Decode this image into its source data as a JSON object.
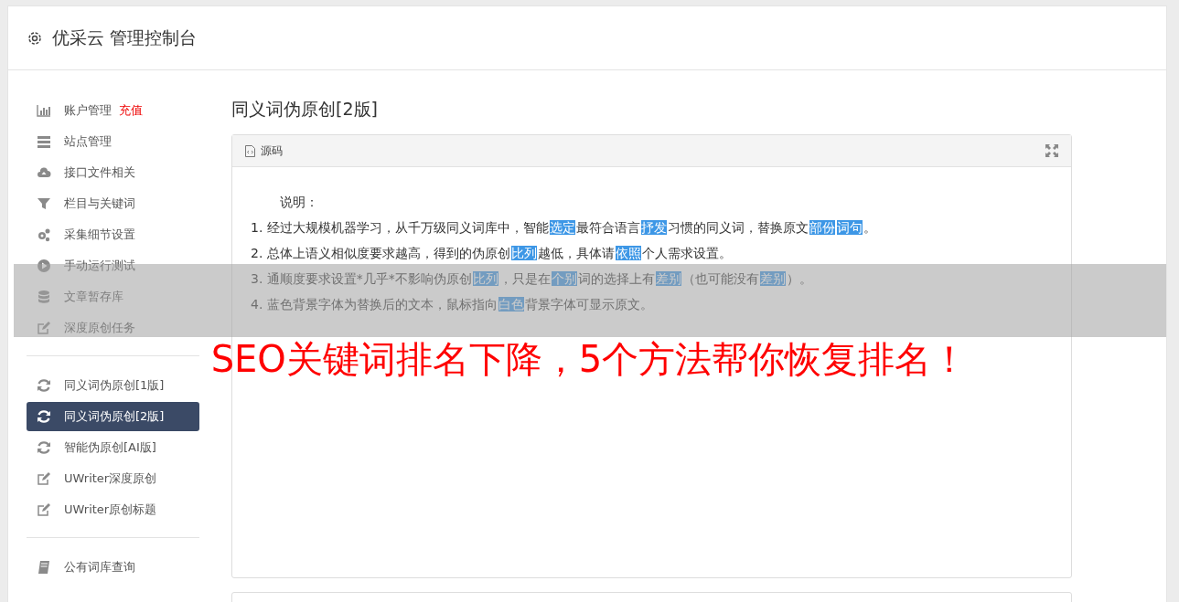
{
  "header": {
    "title": "优采云 管理控制台"
  },
  "sidebar": {
    "groups": [
      {
        "items": [
          {
            "label": "账户管理",
            "badge": "充值",
            "selected": false
          },
          {
            "label": "站点管理",
            "selected": false
          },
          {
            "label": "接口文件相关",
            "selected": false
          },
          {
            "label": "栏目与关键词",
            "selected": false
          },
          {
            "label": "采集细节设置",
            "selected": false
          },
          {
            "label": "手动运行测试",
            "selected": false
          },
          {
            "label": "文章暂存库",
            "selected": false
          },
          {
            "label": "深度原创任务",
            "selected": false
          }
        ]
      },
      {
        "items": [
          {
            "label": "同义词伪原创[1版]",
            "selected": false
          },
          {
            "label": "同义词伪原创[2版]",
            "selected": true
          },
          {
            "label": "智能伪原创[AI版]",
            "selected": false
          },
          {
            "label": "UWriter深度原创",
            "selected": false
          },
          {
            "label": "UWriter原创标题",
            "selected": false
          }
        ]
      },
      {
        "items": [
          {
            "label": "公有词库查询",
            "selected": false
          }
        ]
      }
    ]
  },
  "main": {
    "title": "同义词伪原创[2版]",
    "panel": {
      "tab": "源码",
      "intro": "说明：",
      "lines": [
        [
          {
            "text": "1. 经过大规模机器学习，从千万级同义词库中，智能",
            "highlight": false
          },
          {
            "text": "选定",
            "highlight": true
          },
          {
            "text": "最符合语言",
            "highlight": false
          },
          {
            "text": "抒发",
            "highlight": true
          },
          {
            "text": "习惯的同义词，替换原文",
            "highlight": false
          },
          {
            "text": "部份",
            "highlight": true
          },
          {
            "text": "词句",
            "highlight": true
          },
          {
            "text": "。",
            "highlight": false
          }
        ],
        [
          {
            "text": "2. 总体上语义相似度要求越高，得到的伪原创",
            "highlight": false
          },
          {
            "text": "比列",
            "highlight": true
          },
          {
            "text": "越低，具体请",
            "highlight": false
          },
          {
            "text": "依照",
            "highlight": true
          },
          {
            "text": "个人需求设置。",
            "highlight": false
          }
        ],
        [
          {
            "text": "3. 通顺度要求设置*几乎*不影响伪原创",
            "highlight": false
          },
          {
            "text": "比列",
            "highlight": true
          },
          {
            "text": "，只是在",
            "highlight": false
          },
          {
            "text": "个别",
            "highlight": true
          },
          {
            "text": "词的选择上有",
            "highlight": false
          },
          {
            "text": "差别",
            "highlight": true
          },
          {
            "text": "（也可能没有",
            "highlight": false
          },
          {
            "text": "差别",
            "highlight": true
          },
          {
            "text": "）。",
            "highlight": false
          }
        ],
        [
          {
            "text": "4. 蓝色背景字体为替换后的文本，鼠标指向",
            "highlight": false
          },
          {
            "text": "白色",
            "highlight": true
          },
          {
            "text": "背景字体可显示原文。",
            "highlight": false
          }
        ]
      ]
    }
  },
  "banner": {
    "headline": "SEO关键词排名下降，5个方法帮你恢复排名！"
  }
}
